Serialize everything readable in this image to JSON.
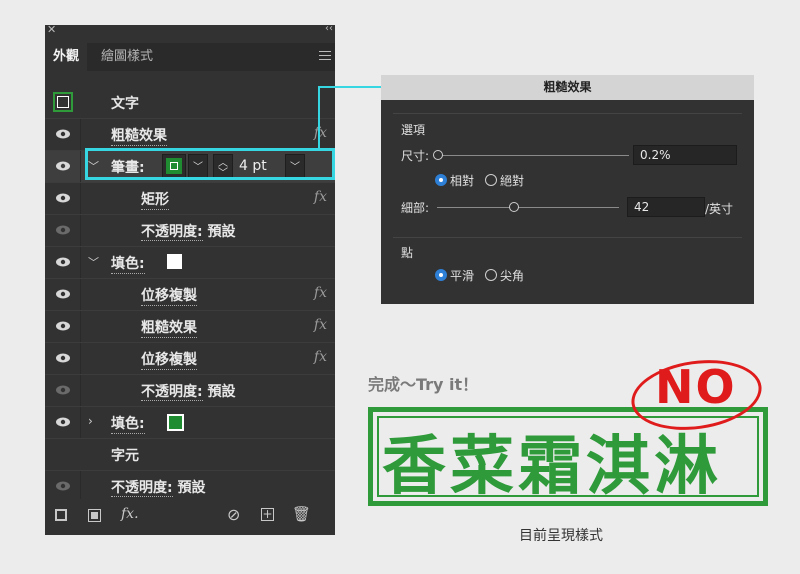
{
  "panel": {
    "tabs": [
      "外觀",
      "繪圖樣式"
    ],
    "rows": [
      {
        "label": "文字"
      },
      {
        "label": "粗糙效果",
        "fx": "fx"
      },
      {
        "label": "筆畫:",
        "stroke_weight": "4 pt"
      },
      {
        "label": "矩形",
        "fx": "fx"
      },
      {
        "label": "不透明度:",
        "value": "預設"
      },
      {
        "label": "填色:"
      },
      {
        "label": "位移複製",
        "fx": "fx"
      },
      {
        "label": "粗糙效果",
        "fx": "fx"
      },
      {
        "label": "位移複製",
        "fx": "fx"
      },
      {
        "label": "不透明度:",
        "value": "預設"
      },
      {
        "label": "填色:"
      },
      {
        "label": "字元"
      },
      {
        "label": "不透明度:",
        "value": "預設"
      }
    ],
    "bottom_fx": "fx."
  },
  "dialog": {
    "title": "粗糙效果",
    "options_label": "選項",
    "size_label": "尺寸:",
    "size_value": "0.2%",
    "size_level": 0.0,
    "relative_label": "相對",
    "absolute_label": "絕對",
    "detail_label": "細部:",
    "detail_value": "42",
    "detail_unit": "/英寸",
    "detail_level": 0.42,
    "points_label": "點",
    "smooth_label": "平滑",
    "corner_label": "尖角"
  },
  "sample": {
    "done_text": "完成～Try it！",
    "stamp_text": "香菜霜淇淋",
    "no_text": "NO",
    "caption": "目前呈現樣式"
  },
  "colors": {
    "stroke_green": "#2f9a3a",
    "fill_white": "#ffffff",
    "fill_green": "#1f8c32",
    "highlight": "#36d6e2",
    "no_red": "#e01b1b"
  }
}
